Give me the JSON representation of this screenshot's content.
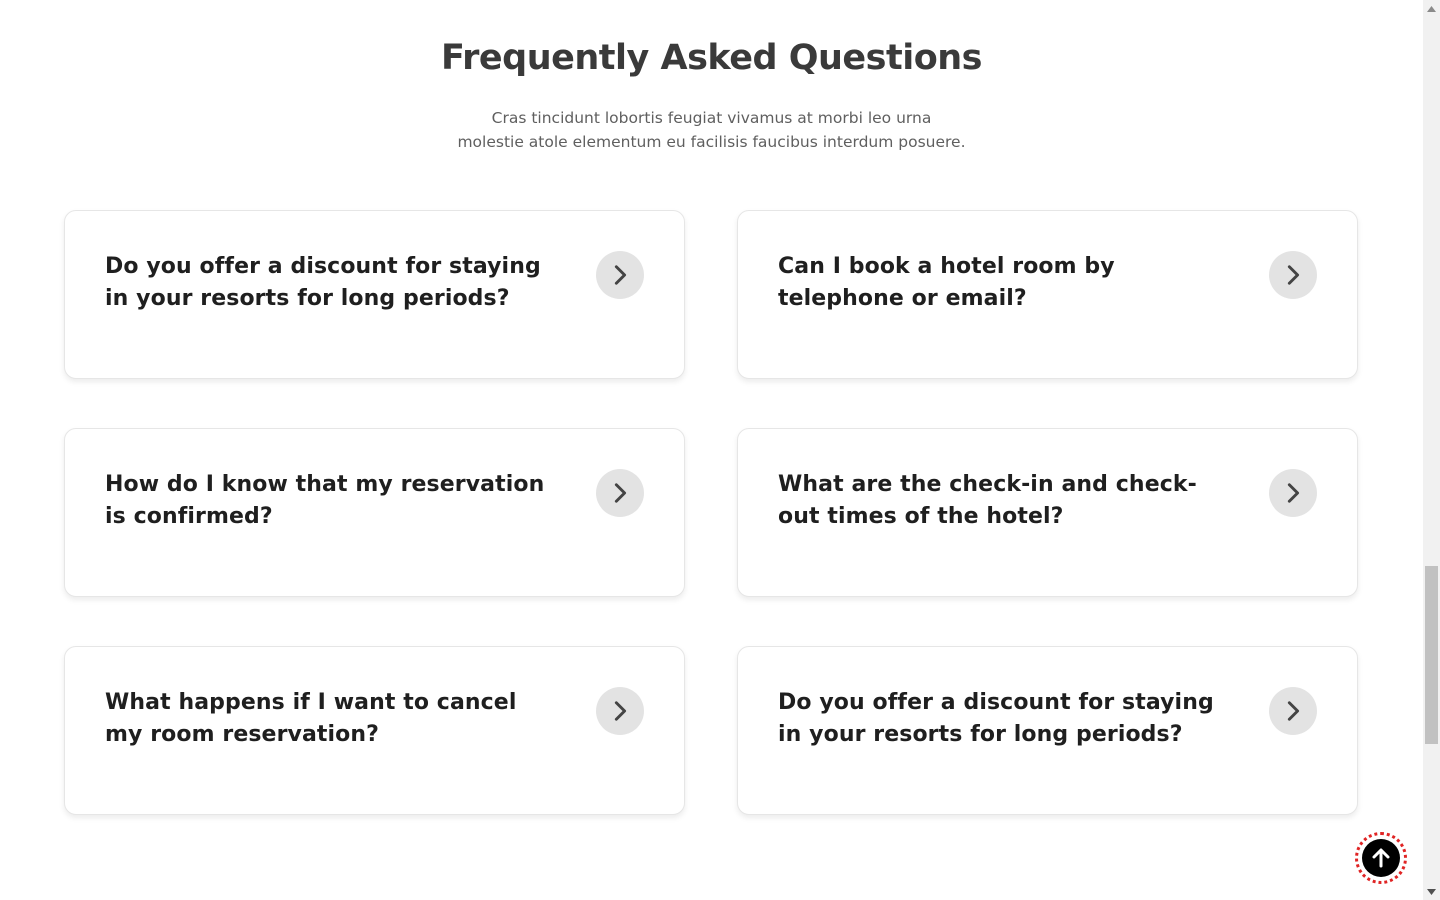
{
  "faq": {
    "title": "Frequently Asked Questions",
    "subtitle_line1": "Cras tincidunt lobortis feugiat vivamus at morbi leo urna",
    "subtitle_line2": "molestie atole elementum eu facilisis faucibus interdum posuere.",
    "items": [
      {
        "question": "Do you offer a discount for staying in your resorts for long periods?",
        "icon": "chevron-right-icon"
      },
      {
        "question": "Can I book a hotel room by telephone or email?",
        "icon": "chevron-right-icon"
      },
      {
        "question": "How do I know that my reservation is confirmed?",
        "icon": "chevron-right-icon"
      },
      {
        "question": "What are the check-in and check-out times of the hotel?",
        "icon": "chevron-right-icon"
      },
      {
        "question": "What happens if I want to cancel my room reservation?",
        "icon": "chevron-right-icon"
      },
      {
        "question": "Do you offer a discount for staying in your resorts for long periods?",
        "icon": "chevron-right-icon"
      }
    ]
  },
  "back_to_top": {
    "icon": "arrow-up-icon",
    "ring_color": "#e02424"
  },
  "colors": {
    "title": "#3a3a3a",
    "question": "#1f1f1f",
    "toggle_bg": "#e3e3e3"
  }
}
